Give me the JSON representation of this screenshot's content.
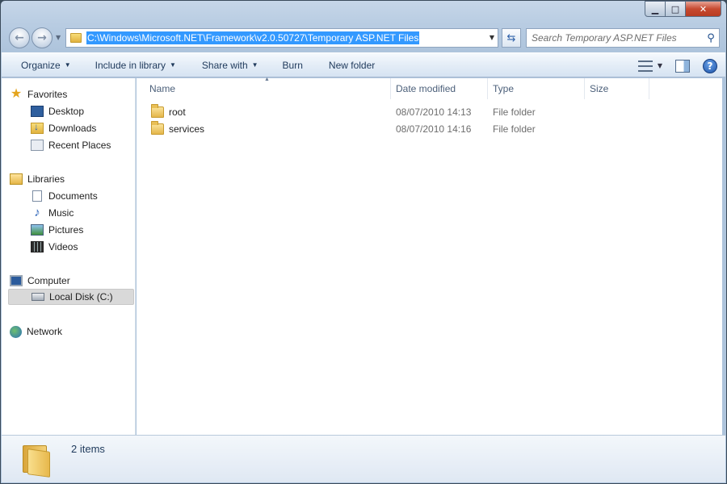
{
  "window": {
    "caption": {
      "minimize": "▁",
      "maximize": "□",
      "close": "✕"
    }
  },
  "address_bar": {
    "path": "C:\\Windows\\Microsoft.NET\\Framework\\v2.0.50727\\Temporary ASP.NET Files",
    "folder_icon": "folder-icon"
  },
  "search": {
    "placeholder": "Search Temporary ASP.NET Files"
  },
  "toolbar": {
    "items": [
      {
        "label": "Organize",
        "dropdown": true
      },
      {
        "label": "Include in library",
        "dropdown": true
      },
      {
        "label": "Share with",
        "dropdown": true
      },
      {
        "label": "Burn",
        "dropdown": false
      },
      {
        "label": "New folder",
        "dropdown": false
      }
    ]
  },
  "nav_pane": {
    "favorites": {
      "label": "Favorites",
      "items": [
        "Desktop",
        "Downloads",
        "Recent Places"
      ]
    },
    "libraries": {
      "label": "Libraries",
      "items": [
        "Documents",
        "Music",
        "Pictures",
        "Videos"
      ]
    },
    "computer": {
      "label": "Computer",
      "items": [
        "Local Disk (C:)"
      ],
      "selected": "Local Disk (C:)"
    },
    "network": {
      "label": "Network"
    }
  },
  "columns": {
    "name": "Name",
    "date_modified": "Date modified",
    "type": "Type",
    "size": "Size",
    "sorted_by": "name"
  },
  "files": [
    {
      "name": "root",
      "date_modified": "08/07/2010 14:13",
      "type": "File folder",
      "size": ""
    },
    {
      "name": "services",
      "date_modified": "08/07/2010 14:16",
      "type": "File folder",
      "size": ""
    }
  ],
  "details_pane": {
    "count": "2 items"
  },
  "colors": {
    "selection": "#3399ff",
    "close_button": "#c74a30",
    "nav_selected": "#d9d9d9"
  }
}
